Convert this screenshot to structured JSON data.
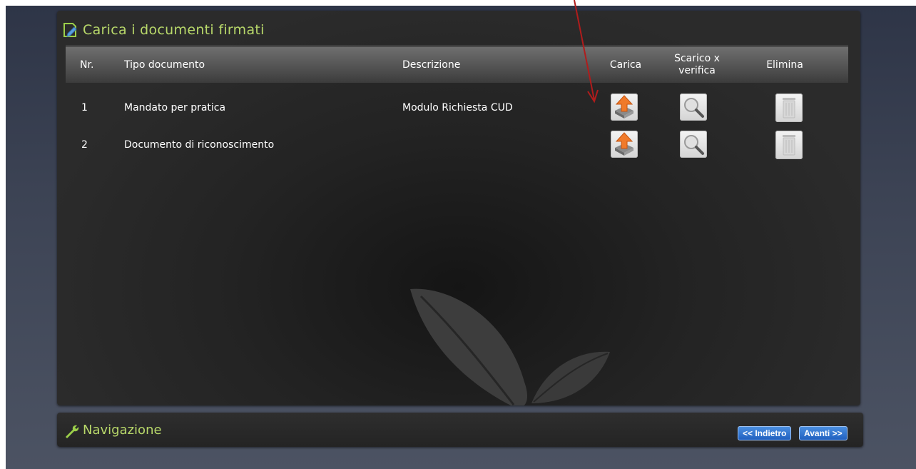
{
  "panel": {
    "title": "Carica i documenti firmati",
    "columns": {
      "nr": "Nr.",
      "tipo": "Tipo documento",
      "descrizione": "Descrizione",
      "carica": "Carica",
      "scarico_line1": "Scarico x",
      "scarico_line2": "verifica",
      "elimina": "Elimina"
    },
    "rows": [
      {
        "nr": "1",
        "tipo": "Mandato per pratica",
        "descrizione": "Modulo Richiesta CUD"
      },
      {
        "nr": "2",
        "tipo": "Documento di riconoscimento",
        "descrizione": ""
      }
    ]
  },
  "navigation": {
    "title": "Navigazione",
    "back_label": "<< Indietro",
    "next_label": "Avanti >>"
  },
  "icons": {
    "upload": "upload-icon",
    "verify": "magnifier-icon",
    "delete": "trash-icon",
    "title": "document-edit-icon",
    "nav": "wrench-icon"
  },
  "colors": {
    "title_green": "#b8d86a",
    "upload_orange": "#f07a2a",
    "nav_button_blue": "#2a6fd0",
    "annotation_arrow": "#b01c1c"
  }
}
